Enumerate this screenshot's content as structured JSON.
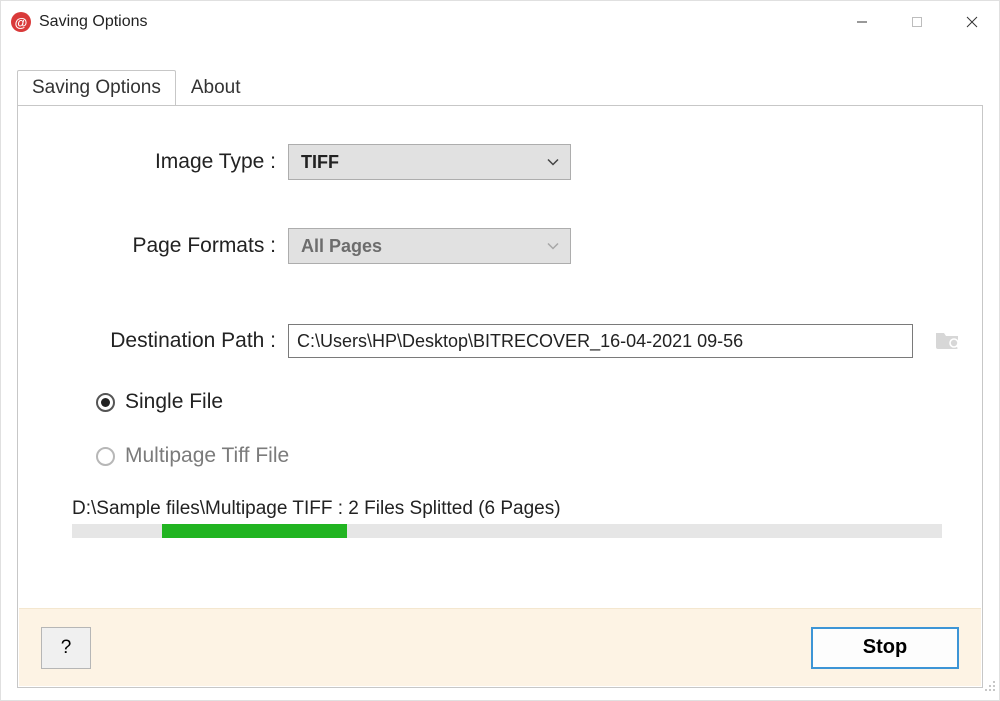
{
  "window": {
    "title": "Saving Options",
    "app_icon_glyph": "@"
  },
  "tabs": {
    "saving_options": "Saving Options",
    "about": "About"
  },
  "labels": {
    "image_type": "Image Type  :",
    "page_formats": "Page Formats  :",
    "destination_path": "Destination Path :"
  },
  "image_type": {
    "value": "TIFF"
  },
  "page_formats": {
    "value": "All Pages"
  },
  "destination_path": {
    "value": "C:\\Users\\HP\\Desktop\\BITRECOVER_16-04-2021 09-56"
  },
  "radios": {
    "single_file": "Single File",
    "multipage_tiff": "Multipage Tiff File"
  },
  "status": "D:\\Sample files\\Multipage TIFF : 2 Files Splitted (6 Pages)",
  "buttons": {
    "help": "?",
    "stop": "Stop"
  }
}
